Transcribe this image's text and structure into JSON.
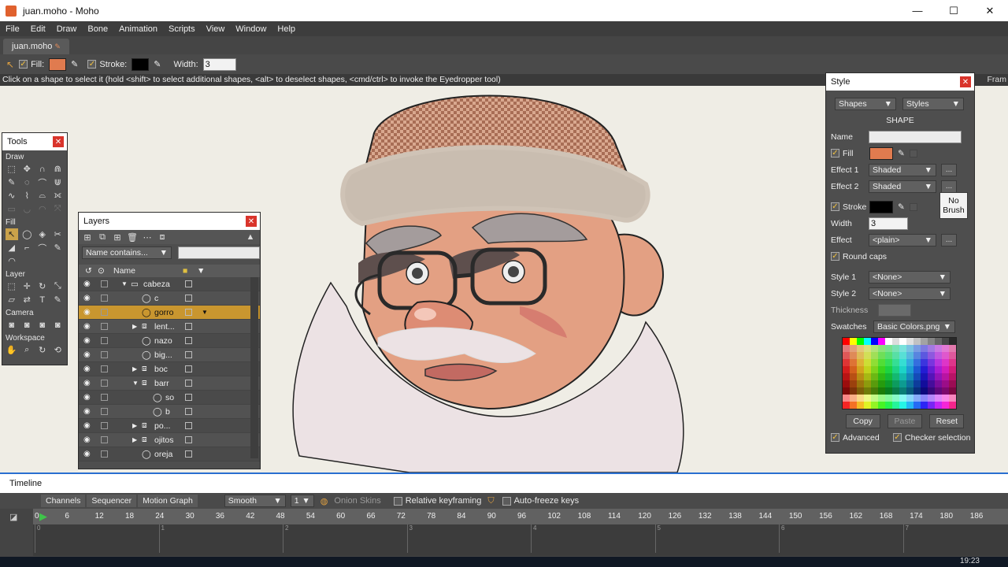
{
  "window": {
    "title": "juan.moho - Moho",
    "minimize": "—",
    "maximize": "☐",
    "close": "✕"
  },
  "menu": [
    "File",
    "Edit",
    "Draw",
    "Bone",
    "Animation",
    "Scripts",
    "View",
    "Window",
    "Help"
  ],
  "doc_tab": "juan.moho",
  "toolbar": {
    "fill_label": "Fill:",
    "stroke_label": "Stroke:",
    "width_label": "Width:",
    "width_value": "3",
    "fill_color": "#e07b4f",
    "stroke_color": "#000000"
  },
  "hint": "Click on a shape to select it (hold <shift> to select additional shapes, <alt> to deselect shapes, <cmd/ctrl> to invoke the Eyedropper tool)",
  "hint_right": "Fram",
  "tools_panel": {
    "title": "Tools",
    "sections": [
      "Draw",
      "Fill",
      "Layer",
      "Camera",
      "Workspace"
    ]
  },
  "layers_panel": {
    "title": "Layers",
    "filter_label": "Name contains...",
    "col_name": "Name",
    "rows": [
      {
        "name": "cabeza",
        "indent": 0,
        "arrow": "▼",
        "type": "folder"
      },
      {
        "name": "c",
        "indent": 1,
        "arrow": "",
        "type": "vector"
      },
      {
        "name": "gorro",
        "indent": 1,
        "arrow": "",
        "type": "vector",
        "selected": true
      },
      {
        "name": "lent...",
        "indent": 1,
        "arrow": "▶",
        "type": "group"
      },
      {
        "name": "nazo",
        "indent": 1,
        "arrow": "",
        "type": "vector"
      },
      {
        "name": "big...",
        "indent": 1,
        "arrow": "",
        "type": "vector"
      },
      {
        "name": "boc",
        "indent": 1,
        "arrow": "▶",
        "type": "group"
      },
      {
        "name": "barr",
        "indent": 1,
        "arrow": "▼",
        "type": "group"
      },
      {
        "name": "so",
        "indent": 2,
        "arrow": "",
        "type": "vector"
      },
      {
        "name": "b",
        "indent": 2,
        "arrow": "",
        "type": "vector"
      },
      {
        "name": "po...",
        "indent": 1,
        "arrow": "▶",
        "type": "group"
      },
      {
        "name": "ojitos",
        "indent": 1,
        "arrow": "▶",
        "type": "group"
      },
      {
        "name": "oreja",
        "indent": 1,
        "arrow": "",
        "type": "vector"
      }
    ]
  },
  "style_panel": {
    "title": "Style",
    "shapes_dropdown": "Shapes",
    "styles_dropdown": "Styles",
    "section": "SHAPE",
    "name_label": "Name",
    "fill_label": "Fill",
    "effect1_label": "Effect 1",
    "effect1_value": "Shaded",
    "effect2_label": "Effect 2",
    "effect2_value": "Shaded",
    "stroke_label": "Stroke",
    "no_brush": "No\nBrush",
    "width_label": "Width",
    "width_value": "3",
    "effect_label": "Effect",
    "effect_value": "<plain>",
    "round_caps": "Round caps",
    "style1_label": "Style 1",
    "style1_value": "<None>",
    "style2_label": "Style 2",
    "style2_value": "<None>",
    "thickness_label": "Thickness",
    "swatches_label": "Swatches",
    "swatches_value": "Basic Colors.png",
    "copy": "Copy",
    "paste": "Paste",
    "reset": "Reset",
    "advanced": "Advanced",
    "checker_selection": "Checker selection",
    "more": "...",
    "fill_color": "#e07b4f",
    "stroke_color": "#000000"
  },
  "timeline": {
    "title": "Timeline",
    "tabs": [
      "Channels",
      "Sequencer",
      "Motion Graph"
    ],
    "interp": "Smooth",
    "interp_value": "1",
    "onion": "Onion Skins",
    "relative": "Relative keyframing",
    "autofreeze": "Auto-freeze keys",
    "ruler": [
      "0",
      "6",
      "12",
      "18",
      "24",
      "30",
      "36",
      "42",
      "48",
      "54",
      "60",
      "66",
      "72",
      "78",
      "84",
      "90",
      "96",
      "102",
      "108",
      "114",
      "120",
      "126",
      "132",
      "138",
      "144",
      "150",
      "156",
      "162",
      "168",
      "174",
      "180",
      "186"
    ],
    "track_marks": [
      "0",
      "1",
      "2",
      "3",
      "4",
      "5",
      "6",
      "7"
    ]
  },
  "taskbar": {
    "clock": "19:23"
  }
}
